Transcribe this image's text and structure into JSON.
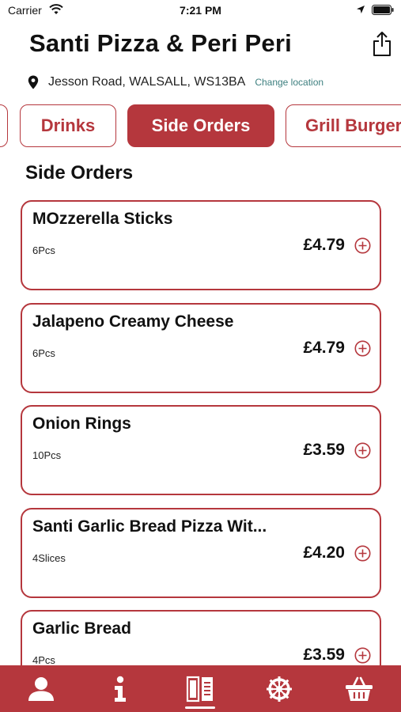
{
  "status_bar": {
    "carrier": "Carrier",
    "time": "7:21 PM"
  },
  "header": {
    "title": "Santi Pizza & Peri Peri",
    "address": "Jesson Road, WALSALL, WS13BA",
    "change_location": "Change location"
  },
  "categories": [
    {
      "label": ""
    },
    {
      "label": "Drinks"
    },
    {
      "label": "Side Orders",
      "active": true
    },
    {
      "label": "Grill Burgers"
    }
  ],
  "section_heading": "Side Orders",
  "items": [
    {
      "name": "MOzzerella Sticks",
      "desc": "6Pcs",
      "price": "£4.79"
    },
    {
      "name": "Jalapeno Creamy Cheese",
      "desc": "6Pcs",
      "price": "£4.79"
    },
    {
      "name": "Onion Rings",
      "desc": "10Pcs",
      "price": "£3.59"
    },
    {
      "name": "Santi Garlic Bread Pizza Wit...",
      "desc": "4Slices",
      "price": "£4.20"
    },
    {
      "name": "Garlic Bread",
      "desc": "4Pcs",
      "price": "£3.59"
    }
  ],
  "bottom_nav": [
    {
      "icon": "person-icon"
    },
    {
      "icon": "info-icon"
    },
    {
      "icon": "menu-icon",
      "active": true
    },
    {
      "icon": "settings-wheel-icon"
    },
    {
      "icon": "basket-icon"
    }
  ],
  "colors": {
    "accent": "#b5373d",
    "link": "#3d7f7f"
  }
}
